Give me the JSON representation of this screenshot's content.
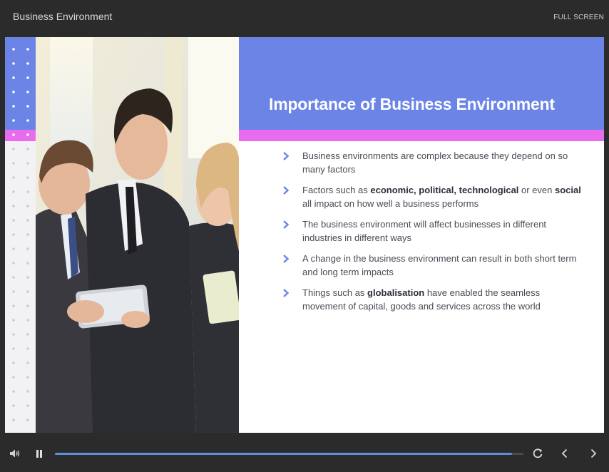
{
  "player": {
    "course_title": "Business Environment",
    "fullscreen_label": "FULL SCREEN",
    "progress": 0.976
  },
  "slide": {
    "title": "Importance of Business Environment",
    "bullets": [
      {
        "parts": [
          {
            "t": "Business environments are complex because they depend on so many factors",
            "b": false
          }
        ]
      },
      {
        "parts": [
          {
            "t": "Factors such as ",
            "b": false
          },
          {
            "t": "economic, political, technological",
            "b": true
          },
          {
            "t": " or even ",
            "b": false
          },
          {
            "t": "social",
            "b": true
          },
          {
            "t": " all impact on how well a business performs",
            "b": false
          }
        ]
      },
      {
        "parts": [
          {
            "t": "The business environment will affect businesses in different industries in different ways",
            "b": false
          }
        ]
      },
      {
        "parts": [
          {
            "t": "A change in the business environment can result in both short term and long term impacts",
            "b": false
          }
        ]
      },
      {
        "parts": [
          {
            "t": "Things such as ",
            "b": false
          },
          {
            "t": "globalisation",
            "b": true
          },
          {
            "t": " have enabled the seamless movement of capital, goods and services across the world",
            "b": false
          }
        ]
      }
    ]
  },
  "colors": {
    "header_blue": "#6b84e6",
    "accent_pink": "#e96bee",
    "chevron": "#6b84e6",
    "progress": "#5b8fd6"
  },
  "icons": {
    "volume": "volume-icon",
    "pause": "pause-icon",
    "replay": "replay-icon",
    "prev": "chevron-left-icon",
    "next": "chevron-right-icon",
    "bullet": "chevron-right-icon"
  }
}
